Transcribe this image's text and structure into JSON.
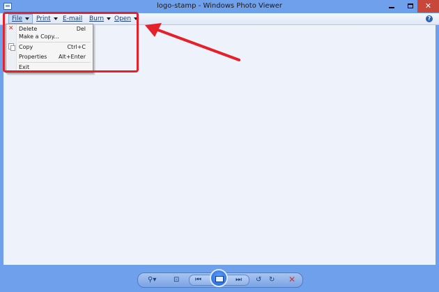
{
  "window": {
    "title": "logo-stamp - Windows Photo Viewer"
  },
  "menubar": {
    "file": "File",
    "print": "Print",
    "email": "E-mail",
    "burn": "Burn",
    "open": "Open"
  },
  "file_menu": {
    "items": [
      {
        "label": "Delete",
        "shortcut": "Del"
      },
      {
        "label": "Make a Copy..."
      },
      {
        "label": "Copy",
        "shortcut": "Ctrl+C"
      },
      {
        "label": "Properties",
        "shortcut": "Alt+Enter"
      },
      {
        "label": "Exit"
      }
    ]
  },
  "icons": {
    "help": "?",
    "close": "✕",
    "delete": "✕"
  },
  "colors": {
    "annotation": "#e5202a",
    "title_bar": "#6fa0ec",
    "close_button": "#c7483b"
  }
}
